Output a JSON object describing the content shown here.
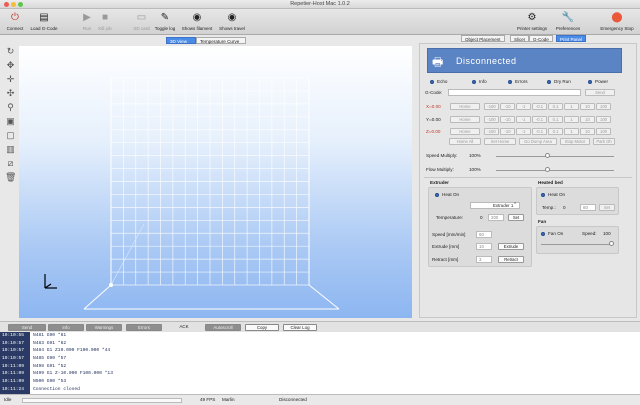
{
  "window": {
    "title": "Repetier-Host Mac 1.0.2"
  },
  "toolbar": {
    "connect": "Connect",
    "load": "Load G-Code",
    "run": "Run",
    "kill": "Kill job",
    "sd": "SD card",
    "toggle_log": "Toggle log",
    "show_filament": "Shows filament",
    "show_travel": "Shows travel",
    "printer_settings": "Printer settings",
    "preferences": "Preferences",
    "emergency": "Emergency Stop"
  },
  "view_tabs": [
    "3D View",
    "Temperature Curve"
  ],
  "right_tabs": [
    "Object Placement",
    "Slicer",
    "G-Code",
    "Print Panel"
  ],
  "print_panel": {
    "status": "Disconnected",
    "checks": [
      "Echo",
      "Info",
      "Errors",
      "Dry Run",
      "Power"
    ],
    "gcode_label": "G-Code:",
    "send": "Send",
    "x_label": "X=0.00",
    "y_label": "Y=0.00",
    "z_label": "Z=0.00",
    "home": "Home",
    "steps": [
      "-100",
      "-10",
      "-1",
      "-0.1",
      "0.1",
      "1",
      "10",
      "100"
    ],
    "home_all": "Home All",
    "set_home": "Set Home",
    "dump_area": "Go Dump Area",
    "stop_motor": "Stop Motor",
    "park": "Park Oh",
    "speed_label": "Speed Multiply:",
    "speed_val": "100%",
    "flow_label": "Flow Multiply:",
    "flow_val": "100%",
    "extruder_title": "Extruder",
    "heat_on": "Heat On",
    "extruder_sel": "Extruder 1",
    "temp_label": "Temperature:",
    "temp_cur": "0",
    "temp_set": "200",
    "set": "Set",
    "speed_mm": "Speed [mm/min]",
    "speed_mm_val": "60",
    "extrude_mm": "Extrude [mm]",
    "extrude_val": "10",
    "extrude_btn": "Extrude",
    "retract_mm": "Retract [mm]",
    "retract_val": "3",
    "retract_btn": "Retract",
    "bed_title": "Heated bed",
    "bed_heat": "Heat On",
    "bed_temp_label": "Temp.:",
    "bed_temp_cur": "0",
    "bed_temp_set": "60",
    "bed_set": "Set",
    "fan_title": "Fan",
    "fan_on": "Fan On",
    "fan_speed_label": "Speed:",
    "fan_speed": "100"
  },
  "log_toolbar": [
    "Send",
    "Info",
    "Warnings",
    "Errors",
    "ACK",
    "Autoscroll",
    "Copy",
    "Clear Log"
  ],
  "log": [
    {
      "t": "19:10:55",
      "m": "N481 G90 *61"
    },
    {
      "t": "19:10:57",
      "m": "N483 G91 *62"
    },
    {
      "t": "19:10:57",
      "m": "N484 G1 Z10.000 F100.000 *44"
    },
    {
      "t": "19:10:57",
      "m": "N485 G90 *57"
    },
    {
      "t": "19:11:09",
      "m": "N498 G91 *52"
    },
    {
      "t": "19:11:09",
      "m": "N499 G1 Z-10.000 F100.000 *13"
    },
    {
      "t": "19:11:09",
      "m": "N500 G90 *53"
    },
    {
      "t": "19:11:24",
      "m": "Connection closed"
    }
  ],
  "statusbar": {
    "idle": "Idle",
    "fps": "49 FPS",
    "firmware": "Marlin",
    "conn": "Disconnected"
  },
  "colors": {
    "accent": "#4a8be8",
    "status_bg": "#5a84c4",
    "emergency": "#e85a3a"
  }
}
